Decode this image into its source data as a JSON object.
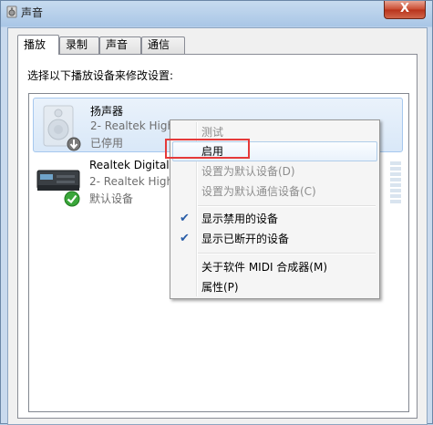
{
  "window": {
    "title": "声音",
    "close_label": "X",
    "title_icon": "speaker-icon"
  },
  "tabs": [
    {
      "label": "播放",
      "active": true
    },
    {
      "label": "录制",
      "active": false
    },
    {
      "label": "声音",
      "active": false
    },
    {
      "label": "通信",
      "active": false
    }
  ],
  "instruction": "选择以下播放设备来修改设置:",
  "devices": [
    {
      "name": "扬声器",
      "line2": "2- Realtek High",
      "line3": "已停用",
      "icon": "speaker-icon",
      "badge": "down-arrow-icon",
      "selected": true
    },
    {
      "name": "Realtek Digital (",
      "line2": "2- Realtek High",
      "line3": "默认设备",
      "icon": "digital-output-icon",
      "badge": "green-check-icon",
      "selected": false
    }
  ],
  "context_menu": {
    "items": [
      {
        "label": "测试",
        "disabled": true,
        "checked": false
      },
      {
        "label": "启用",
        "disabled": false,
        "checked": false,
        "highlighted": true
      },
      {
        "label": "设置为默认设备(D)",
        "disabled": true,
        "checked": false
      },
      {
        "label": "设置为默认通信设备(C)",
        "disabled": true,
        "checked": false
      },
      {
        "label": "显示禁用的设备",
        "disabled": false,
        "checked": true
      },
      {
        "label": "显示已断开的设备",
        "disabled": false,
        "checked": true
      },
      {
        "label": "关于软件 MIDI 合成器(M)",
        "disabled": false,
        "checked": false
      },
      {
        "label": "属性(P)",
        "disabled": false,
        "checked": false
      }
    ]
  },
  "colors": {
    "highlight_box": "#e53a3a",
    "check_mark": "#2a5ea8",
    "selected_row": "#d9e8f8"
  }
}
